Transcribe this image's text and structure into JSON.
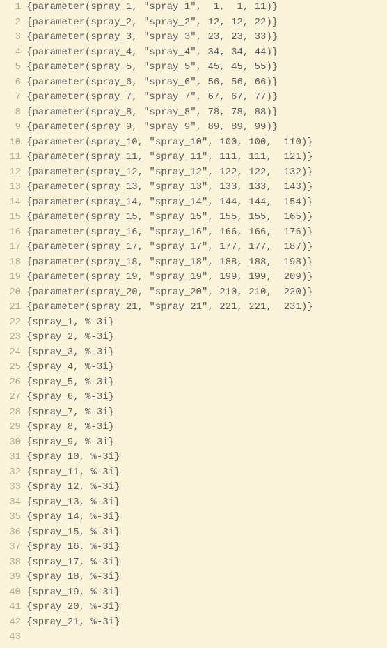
{
  "lines": [
    "{parameter(spray_1, \"spray_1\",  1,  1, 11)}",
    "{parameter(spray_2, \"spray_2\", 12, 12, 22)}",
    "{parameter(spray_3, \"spray_3\", 23, 23, 33)}",
    "{parameter(spray_4, \"spray_4\", 34, 34, 44)}",
    "{parameter(spray_5, \"spray_5\", 45, 45, 55)}",
    "{parameter(spray_6, \"spray_6\", 56, 56, 66)}",
    "{parameter(spray_7, \"spray_7\", 67, 67, 77)}",
    "{parameter(spray_8, \"spray_8\", 78, 78, 88)}",
    "{parameter(spray_9, \"spray_9\", 89, 89, 99)}",
    "{parameter(spray_10, \"spray_10\", 100, 100,  110)}",
    "{parameter(spray_11, \"spray_11\", 111, 111,  121)}",
    "{parameter(spray_12, \"spray_12\", 122, 122,  132)}",
    "{parameter(spray_13, \"spray_13\", 133, 133,  143)}",
    "{parameter(spray_14, \"spray_14\", 144, 144,  154)}",
    "{parameter(spray_15, \"spray_15\", 155, 155,  165)}",
    "{parameter(spray_16, \"spray_16\", 166, 166,  176)}",
    "{parameter(spray_17, \"spray_17\", 177, 177,  187)}",
    "{parameter(spray_18, \"spray_18\", 188, 188,  198)}",
    "{parameter(spray_19, \"spray_19\", 199, 199,  209)}",
    "{parameter(spray_20, \"spray_20\", 210, 210,  220)}",
    "{parameter(spray_21, \"spray_21\", 221, 221,  231)}",
    "{spray_1, %-3i}",
    "{spray_2, %-3i}",
    "{spray_3, %-3i}",
    "{spray_4, %-3i}",
    "{spray_5, %-3i}",
    "{spray_6, %-3i}",
    "{spray_7, %-3i}",
    "{spray_8, %-3i}",
    "{spray_9, %-3i}",
    "{spray_10, %-3i}",
    "{spray_11, %-3i}",
    "{spray_12, %-3i}",
    "{spray_13, %-3i}",
    "{spray_14, %-3i}",
    "{spray_15, %-3i}",
    "{spray_16, %-3i}",
    "{spray_17, %-3i}",
    "{spray_18, %-3i}",
    "{spray_19, %-3i}",
    "{spray_20, %-3i}",
    "{spray_21, %-3i}",
    ""
  ]
}
